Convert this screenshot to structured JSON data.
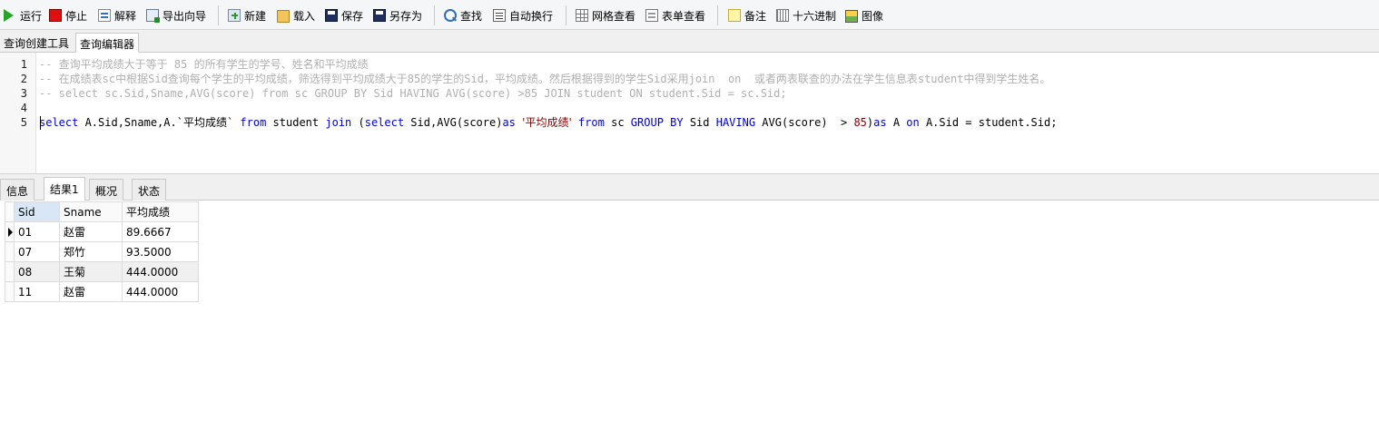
{
  "toolbar": {
    "run": "运行",
    "stop": "停止",
    "explain": "解释",
    "export_wizard": "导出向导",
    "new": "新建",
    "load": "载入",
    "save": "保存",
    "save_as": "另存为",
    "find": "查找",
    "word_wrap": "自动换行",
    "grid_view": "网格查看",
    "form_view": "表单查看",
    "memo": "备注",
    "hex": "十六进制",
    "image": "图像"
  },
  "editor_tabs": [
    "查询创建工具",
    "查询编辑器"
  ],
  "editor": {
    "line_numbers": [
      "1",
      "2",
      "3",
      "4",
      "5"
    ],
    "line1": "-- 查询平均成绩大于等于 85 的所有学生的学号、姓名和平均成绩",
    "line2": "-- 在成绩表sc中根据Sid查询每个学生的平均成绩，筛选得到平均成绩大于85的学生的Sid，平均成绩。然后根据得到的学生Sid采用join  on  或者两表联查的办法在学生信息表student中得到学生姓名。",
    "line3": "-- select sc.Sid,Sname,AVG(score) from sc GROUP BY Sid HAVING AVG(score) >85 JOIN student ON student.Sid = sc.Sid;",
    "line5_tokens": {
      "t1": "select",
      "t2": " A.Sid,Sname,A.`",
      "t3": "平均成绩",
      "t4": "` ",
      "t5": "from",
      "t6": " student ",
      "t7": "join",
      "t8": " (",
      "t9": "select",
      "t10": " Sid,AVG(score)",
      "t11": "as",
      "t12": " ",
      "t13": "'平均成绩'",
      "t14": " ",
      "t15": "from",
      "t16": " sc ",
      "t17": "GROUP BY",
      "t18": " Sid ",
      "t19": "HAVING",
      "t20": " AVG(score)  > ",
      "t21": "85",
      "t22": ")",
      "t23": "as",
      "t24": " A ",
      "t25": "on",
      "t26": " A.Sid = student.Sid;"
    }
  },
  "result_tabs": [
    "信息",
    "结果1",
    "概况",
    "状态"
  ],
  "grid": {
    "columns": [
      "Sid",
      "Sname",
      "平均成绩"
    ],
    "rows": [
      [
        "01",
        "赵雷",
        "89.6667"
      ],
      [
        "07",
        "郑竹",
        "93.5000"
      ],
      [
        "08",
        "王菊",
        "444.0000"
      ],
      [
        "11",
        "赵雷",
        "444.0000"
      ]
    ]
  }
}
